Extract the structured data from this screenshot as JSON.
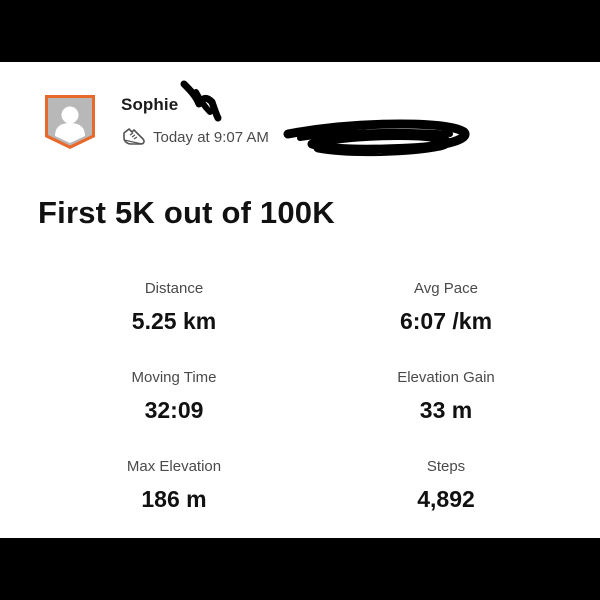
{
  "activity": {
    "athlete_name": "Sophie",
    "timestamp": "Today at 9:07 AM",
    "title": "First 5K out of 100K",
    "activity_icon": "running-shoe-icon"
  },
  "stats": [
    {
      "label": "Distance",
      "value": "5.25 km"
    },
    {
      "label": "Avg Pace",
      "value": "6:07 /km"
    },
    {
      "label": "Moving Time",
      "value": "32:09"
    },
    {
      "label": "Elevation Gain",
      "value": "33 m"
    },
    {
      "label": "Max Elevation",
      "value": "186 m"
    },
    {
      "label": "Steps",
      "value": "4,892"
    }
  ],
  "colors": {
    "avatar_border": "#e8692c",
    "avatar_fill": "#b9b9b9",
    "background": "#ffffff",
    "letterbox": "#000000"
  }
}
